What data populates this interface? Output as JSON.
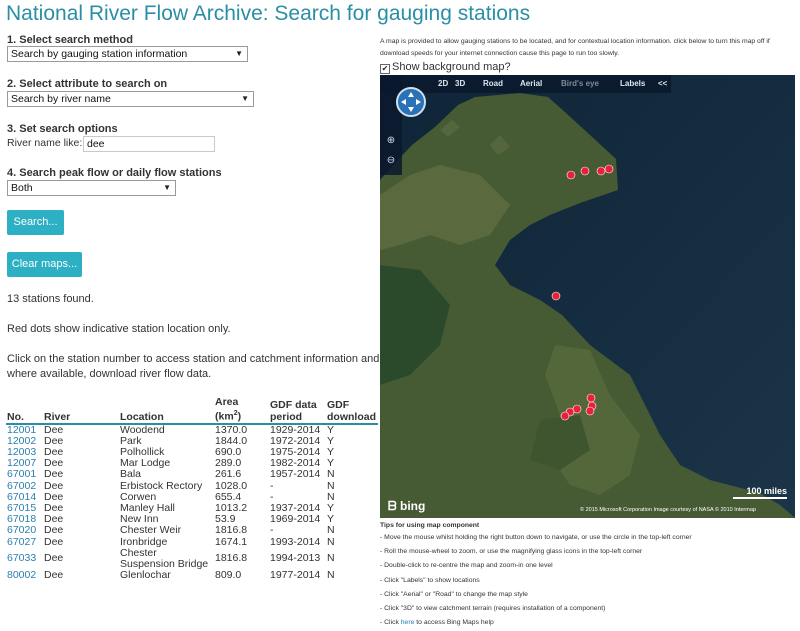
{
  "page": {
    "title": "National River Flow Archive: Search for gauging stations"
  },
  "form": {
    "step1": {
      "label": "1. Select search method",
      "value": "Search by gauging station information"
    },
    "step2": {
      "label": "2. Select attribute to search on",
      "value": "Search by river name"
    },
    "step3": {
      "label": "3. Set search options",
      "field_label": "River name like:",
      "field_value": "dee"
    },
    "step4": {
      "label": "4. Search peak flow or daily flow stations",
      "value": "Both"
    },
    "search_button": "Search...",
    "clear_maps_button": "Clear maps..."
  },
  "results": {
    "count_text": "13 stations found.",
    "note_red_dots": "Red dots show indicative station location only.",
    "note_click": "Click on the station number to access station and catchment information and,",
    "note_click2": "where available, download river flow data.",
    "headers": {
      "no": "No.",
      "river": "River",
      "location": "Location",
      "area": "Area (km",
      "area_sup": "2",
      "area_end": ")",
      "gdf_period_line1": "GDF data",
      "gdf_period_line2": "period",
      "gdf_download_line1": "GDF",
      "gdf_download_line2": "download"
    },
    "rows": [
      {
        "no": "12001",
        "river": "Dee",
        "location": "Woodend",
        "area": "1370.0",
        "period": "1929-2014",
        "download": "Y"
      },
      {
        "no": "12002",
        "river": "Dee",
        "location": "Park",
        "area": "1844.0",
        "period": "1972-2014",
        "download": "Y"
      },
      {
        "no": "12003",
        "river": "Dee",
        "location": "Polhollick",
        "area": "690.0",
        "period": "1975-2014",
        "download": "Y"
      },
      {
        "no": "12007",
        "river": "Dee",
        "location": "Mar Lodge",
        "area": "289.0",
        "period": "1982-2014",
        "download": "Y"
      },
      {
        "no": "67001",
        "river": "Dee",
        "location": "Bala",
        "area": "261.6",
        "period": "1957-2014",
        "download": "N"
      },
      {
        "no": "67002",
        "river": "Dee",
        "location": "Erbistock Rectory",
        "area": "1028.0",
        "period": "-",
        "download": "N"
      },
      {
        "no": "67014",
        "river": "Dee",
        "location": "Corwen",
        "area": "655.4",
        "period": "-",
        "download": "N"
      },
      {
        "no": "67015",
        "river": "Dee",
        "location": "Manley Hall",
        "area": "1013.2",
        "period": "1937-2014",
        "download": "Y"
      },
      {
        "no": "67018",
        "river": "Dee",
        "location": "New Inn",
        "area": "53.9",
        "period": "1969-2014",
        "download": "Y"
      },
      {
        "no": "67020",
        "river": "Dee",
        "location": "Chester Weir",
        "area": "1816.8",
        "period": "-",
        "download": "N"
      },
      {
        "no": "67027",
        "river": "Dee",
        "location": "Ironbridge",
        "area": "1674.1",
        "period": "1993-2014",
        "download": "N"
      },
      {
        "no": "67033",
        "river": "Dee",
        "location": "Chester",
        "location2": "Suspension Bridge",
        "area": "1816.8",
        "period": "1994-2013",
        "download": "N"
      },
      {
        "no": "80002",
        "river": "Dee",
        "location": "Glenlochar",
        "area": "809.0",
        "period": "1977-2014",
        "download": "N"
      }
    ]
  },
  "map": {
    "note": "A map is provided to allow gauging stations to be located, and for contextual location information. click below to turn this map off if download speeds for your internet connection cause this page to run too slowly.",
    "show_background_label": "Show background map?",
    "show_background_checked": true,
    "toolbar": {
      "d2": "2D",
      "d3": "3D",
      "road": "Road",
      "aerial": "Aerial",
      "birds_eye": "Bird's eye",
      "labels": "Labels",
      "collapse": "<<"
    },
    "scale_label": "100 miles",
    "copyright": "© 2015 Microsoft Corporation    Image courtesy of NASA    © 2010 Intermap",
    "logo": "bing",
    "colors": {
      "sea": "#132a3f",
      "land": "#4b5a35",
      "marker": "#e8203a",
      "toolbar": "#0a192d"
    },
    "icons": [
      "navigation-circle-icon",
      "zoom-in-icon",
      "zoom-out-icon",
      "station-marker-icon"
    ]
  },
  "tips": {
    "title": "Tips for using map component",
    "items": [
      "- Move the mouse whilst holding the right button down to navigate, or use the circle in the top-left corner",
      "- Roll the mouse-wheel to zoom, or use the magnifying glass icons in the top-left corner",
      "- Double-click to re-centre the map and zoom-in one level",
      "- Click \"Labels\" to show locations",
      "- Click \"Aerial\" or \"Road\" to change the map style",
      "- Click \"3D\" to view catchment terrain (requires installation of a component)"
    ],
    "last_prefix": "- Click ",
    "last_link": "here",
    "last_suffix": " to access Bing Maps help"
  }
}
